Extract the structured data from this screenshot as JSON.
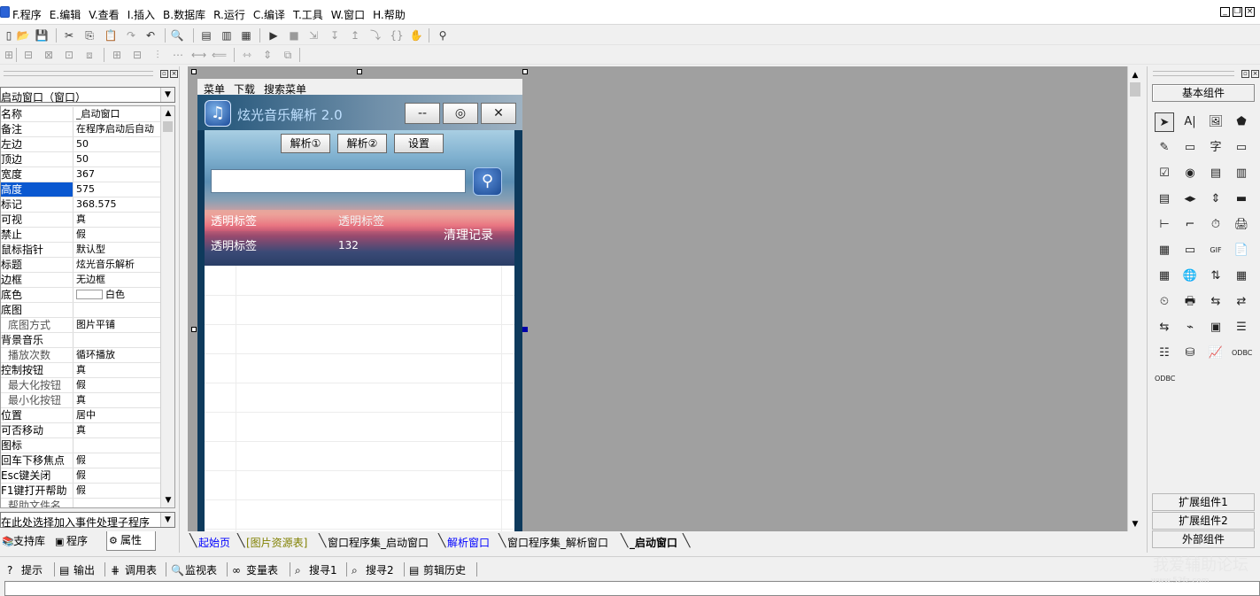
{
  "menu": {
    "items": [
      "F.程序",
      "E.编辑",
      "V.查看",
      "I.插入",
      "B.数据库",
      "R.运行",
      "C.编译",
      "T.工具",
      "W.窗口",
      "H.帮助"
    ],
    "window_controls": [
      "_",
      "❐",
      "×"
    ]
  },
  "toolbar1": [
    {
      "name": "new-file-icon",
      "glyph": "▯"
    },
    {
      "name": "open-file-icon",
      "glyph": "📂"
    },
    {
      "name": "save-icon",
      "glyph": "💾"
    },
    {
      "name": "cut-icon",
      "glyph": "✂"
    },
    {
      "name": "copy-icon",
      "glyph": "⎘"
    },
    {
      "name": "paste-icon",
      "glyph": "📋"
    },
    {
      "name": "redo-icon",
      "glyph": "↷"
    },
    {
      "name": "undo-icon",
      "glyph": "↶"
    },
    {
      "name": "find-icon",
      "glyph": "🔍"
    },
    {
      "name": "layout-1-icon",
      "glyph": "▤"
    },
    {
      "name": "layout-2-icon",
      "glyph": "▥"
    },
    {
      "name": "layout-3-icon",
      "glyph": "▦"
    },
    {
      "name": "run-icon",
      "glyph": "▶"
    },
    {
      "name": "stop-icon",
      "glyph": "■"
    },
    {
      "name": "step-1-icon",
      "glyph": "⇲"
    },
    {
      "name": "step-2-icon",
      "glyph": "↧"
    },
    {
      "name": "step-3-icon",
      "glyph": "↥"
    },
    {
      "name": "step-4-icon",
      "glyph": "⤵"
    },
    {
      "name": "braces-icon",
      "glyph": "{}"
    },
    {
      "name": "hand-icon",
      "glyph": "✋"
    },
    {
      "name": "binoculars-icon",
      "glyph": "⚲"
    }
  ],
  "toolbar2": [
    {
      "name": "align-1-icon",
      "glyph": "⊞"
    },
    {
      "name": "align-2-icon",
      "glyph": "⊟"
    },
    {
      "name": "align-3-icon",
      "glyph": "⊠"
    },
    {
      "name": "align-4-icon",
      "glyph": "⊡"
    },
    {
      "name": "align-5-icon",
      "glyph": "⧈"
    },
    {
      "name": "center-1-icon",
      "glyph": "⊞"
    },
    {
      "name": "center-2-icon",
      "glyph": "⊟"
    },
    {
      "name": "space-1-icon",
      "glyph": "⫶"
    },
    {
      "name": "space-2-icon",
      "glyph": "⋯"
    },
    {
      "name": "space-3-icon",
      "glyph": "⟷"
    },
    {
      "name": "space-4-icon",
      "glyph": "⟸"
    },
    {
      "name": "size-1-icon",
      "glyph": "⇿"
    },
    {
      "name": "size-2-icon",
      "glyph": "⇕"
    },
    {
      "name": "size-3-icon",
      "glyph": "⧉"
    }
  ],
  "left_panel": {
    "object_selector": "启动窗口（窗口）",
    "properties": [
      {
        "name": "名称",
        "value": "_启动窗口"
      },
      {
        "name": "备注",
        "value": "在程序启动后自动"
      },
      {
        "name": "左边",
        "value": "50"
      },
      {
        "name": "顶边",
        "value": "50"
      },
      {
        "name": "宽度",
        "value": "367"
      },
      {
        "name": "高度",
        "value": "575",
        "selected": true
      },
      {
        "name": "标记",
        "value": "368.575"
      },
      {
        "name": "可视",
        "value": "真"
      },
      {
        "name": "禁止",
        "value": "假"
      },
      {
        "name": "鼠标指针",
        "value": "默认型"
      },
      {
        "name": "标题",
        "value": "炫光音乐解析"
      },
      {
        "name": "边框",
        "value": "无边框"
      },
      {
        "name": "底色",
        "value": "白色",
        "swatch": "#ffffff"
      },
      {
        "name": "底图",
        "value": ""
      },
      {
        "name": "底图方式",
        "value": "图片平铺",
        "sub": true
      },
      {
        "name": "背景音乐",
        "value": ""
      },
      {
        "name": "播放次数",
        "value": "循环播放",
        "sub": true
      },
      {
        "name": "控制按钮",
        "value": "真"
      },
      {
        "name": "最大化按钮",
        "value": "假",
        "sub": true
      },
      {
        "name": "最小化按钮",
        "value": "真",
        "sub": true
      },
      {
        "name": "位置",
        "value": "居中"
      },
      {
        "name": "可否移动",
        "value": "真"
      },
      {
        "name": "图标",
        "value": ""
      },
      {
        "name": "回车下移焦点",
        "value": "假"
      },
      {
        "name": "Esc键关闭",
        "value": "假"
      },
      {
        "name": "F1键打开帮助",
        "value": "假"
      },
      {
        "name": "帮助文件名",
        "value": "",
        "sub": true
      }
    ],
    "event_selector": "在此处选择加入事件处理子程序",
    "tabs": [
      {
        "label": "支持库",
        "icon": "book-icon",
        "glyph": "📚"
      },
      {
        "label": "程序",
        "icon": "program-icon",
        "glyph": "▣"
      },
      {
        "label": "属性",
        "icon": "property-icon",
        "glyph": "⚙",
        "active": true
      }
    ]
  },
  "form": {
    "menu": [
      "菜单",
      "下载",
      "搜索菜单"
    ],
    "title": "炫光音乐解析  2.0",
    "buttons": [
      "--",
      "◎",
      "✕"
    ],
    "action_buttons": [
      "解析①",
      "解析②",
      "设置"
    ],
    "search_value": "",
    "labels": {
      "l1": "透明标签",
      "l2": "透明标签",
      "l3": "透明标签",
      "l4": "132",
      "clear": "清理记录"
    }
  },
  "design_tabs": [
    {
      "label": "起始页",
      "style": "link"
    },
    {
      "label": "[图片资源表]",
      "style": "olive"
    },
    {
      "label": "窗口程序集_启动窗口",
      "style": "normal"
    },
    {
      "label": "解析窗口",
      "style": "link"
    },
    {
      "label": "窗口程序集_解析窗口",
      "style": "normal"
    },
    {
      "label": "_启动窗口",
      "style": "active"
    }
  ],
  "right_panel": {
    "basic": "基本组件",
    "ext1": "扩展组件1",
    "ext2": "扩展组件2",
    "external": "外部组件",
    "components": [
      {
        "name": "pointer-icon",
        "glyph": "➤",
        "sel": true
      },
      {
        "name": "label-icon",
        "glyph": "A|"
      },
      {
        "name": "image-icon",
        "glyph": "🖼"
      },
      {
        "name": "shape-icon",
        "glyph": "⬟"
      },
      {
        "name": "edit-icon",
        "glyph": "✎"
      },
      {
        "name": "picture-box-icon",
        "glyph": "▭"
      },
      {
        "name": "text-char-icon",
        "glyph": "字"
      },
      {
        "name": "frame-icon",
        "glyph": "▭"
      },
      {
        "name": "checkbox-icon",
        "glyph": "☑"
      },
      {
        "name": "radio-icon",
        "glyph": "◉"
      },
      {
        "name": "listbox-icon",
        "glyph": "▤"
      },
      {
        "name": "combobox-icon",
        "glyph": "▥"
      },
      {
        "name": "list-icon",
        "glyph": "▤"
      },
      {
        "name": "hscroll-icon",
        "glyph": "◂▸"
      },
      {
        "name": "vscroll-icon",
        "glyph": "⇕"
      },
      {
        "name": "progress-icon",
        "glyph": "▬"
      },
      {
        "name": "slider-icon",
        "glyph": "⊢"
      },
      {
        "name": "tab-icon",
        "glyph": "⌐"
      },
      {
        "name": "timer-icon",
        "glyph": "⏱"
      },
      {
        "name": "print-icon",
        "glyph": "🖨"
      },
      {
        "name": "grid-icon",
        "glyph": "▦"
      },
      {
        "name": "button-icon",
        "glyph": "▭"
      },
      {
        "name": "gif-icon",
        "glyph": "GIF"
      },
      {
        "name": "document-icon",
        "glyph": "📄"
      },
      {
        "name": "table-icon",
        "glyph": "▦"
      },
      {
        "name": "network-icon",
        "glyph": "🌐"
      },
      {
        "name": "spin-icon",
        "glyph": "⇅"
      },
      {
        "name": "calendar-icon",
        "glyph": "▦"
      },
      {
        "name": "stopwatch-icon",
        "glyph": "⏲"
      },
      {
        "name": "printer-icon",
        "glyph": "🖶"
      },
      {
        "name": "transfer-1-icon",
        "glyph": "⇆"
      },
      {
        "name": "transfer-2-icon",
        "glyph": "⇄"
      },
      {
        "name": "transfer-3-icon",
        "glyph": "⇆"
      },
      {
        "name": "plug-icon",
        "glyph": "⌁"
      },
      {
        "name": "window-icon",
        "glyph": "▣"
      },
      {
        "name": "layers-icon",
        "glyph": "☰"
      },
      {
        "name": "db-list-icon",
        "glyph": "☷"
      },
      {
        "name": "db-icon",
        "glyph": "⛁"
      },
      {
        "name": "chart-icon",
        "glyph": "📈"
      },
      {
        "name": "odbc-icon",
        "glyph": "ODBC"
      },
      {
        "name": "odbc-db-icon",
        "glyph": "ODBC"
      }
    ]
  },
  "output_tabs": [
    {
      "label": "提示",
      "icon": "hint-icon",
      "glyph": "?"
    },
    {
      "label": "输出",
      "icon": "output-icon",
      "glyph": "▤"
    },
    {
      "label": "调用表",
      "icon": "call-table-icon",
      "glyph": "⋕"
    },
    {
      "label": "监视表",
      "icon": "watch-icon",
      "glyph": "🔍"
    },
    {
      "label": "变量表",
      "icon": "variable-icon",
      "glyph": "∞"
    },
    {
      "label": "搜寻1",
      "icon": "search1-icon",
      "glyph": "⌕"
    },
    {
      "label": "搜寻2",
      "icon": "search2-icon",
      "glyph": "⌕"
    },
    {
      "label": "剪辑历史",
      "icon": "clip-history-icon",
      "glyph": "▤"
    }
  ],
  "watermark": {
    "main": "我爱辅助论坛",
    "sub": "www.52fz.com"
  }
}
